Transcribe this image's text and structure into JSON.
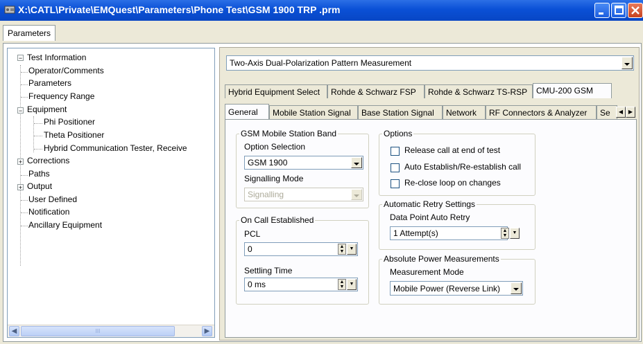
{
  "window": {
    "title": "X:\\CATL\\Private\\EMQuest\\Parameters\\Phone Test\\GSM 1900 TRP .prm",
    "top_tab": "Parameters"
  },
  "tree": {
    "items": [
      {
        "label": "Test Information"
      },
      {
        "label": "Operator/Comments"
      },
      {
        "label": "Parameters"
      },
      {
        "label": "Frequency Range"
      },
      {
        "label": "Equipment"
      },
      {
        "label": "Phi Positioner"
      },
      {
        "label": "Theta Positioner"
      },
      {
        "label": "Hybrid Communication Tester, Receive"
      },
      {
        "label": "Corrections"
      },
      {
        "label": "Paths"
      },
      {
        "label": "Output"
      },
      {
        "label": "User Defined"
      },
      {
        "label": "Notification"
      },
      {
        "label": "Ancillary Equipment"
      }
    ],
    "scroll_thumb_glyph": "III"
  },
  "measurement_select": {
    "value": "Two-Axis Dual-Polarization Pattern Measurement"
  },
  "equipment_tabs": [
    "Hybrid Equipment Select",
    "Rohde & Schwarz FSP",
    "Rohde & Schwarz TS-RSP",
    "CMU-200 GSM"
  ],
  "sub_tabs": [
    "General",
    "Mobile Station Signal",
    "Base Station Signal",
    "Network",
    "RF Connectors & Analyzer",
    "Se"
  ],
  "gsm_band": {
    "title": "GSM Mobile Station Band",
    "option_label": "Option Selection",
    "option_value": "GSM 1900",
    "signalling_label": "Signalling Mode",
    "signalling_value": "Signalling"
  },
  "on_call": {
    "title": "On Call Established",
    "pcl_label": "PCL",
    "pcl_value": "0",
    "settling_label": "Settling Time",
    "settling_value": "0 ms"
  },
  "options": {
    "title": "Options",
    "items": [
      {
        "label": "Release call at end of test",
        "checked": false
      },
      {
        "label": "Auto Establish/Re-establish call",
        "checked": false
      },
      {
        "label": "Re-close loop on changes",
        "checked": false
      }
    ]
  },
  "retry": {
    "title": "Automatic Retry Settings",
    "label": "Data Point Auto Retry",
    "value": "1 Attempt(s)"
  },
  "absolute_power": {
    "title": "Absolute Power Measurements",
    "label": "Measurement Mode",
    "value": "Mobile Power (Reverse Link)"
  },
  "colors": {
    "titlebar": "#0a50d6",
    "dialog_bg": "#ece9d8"
  }
}
